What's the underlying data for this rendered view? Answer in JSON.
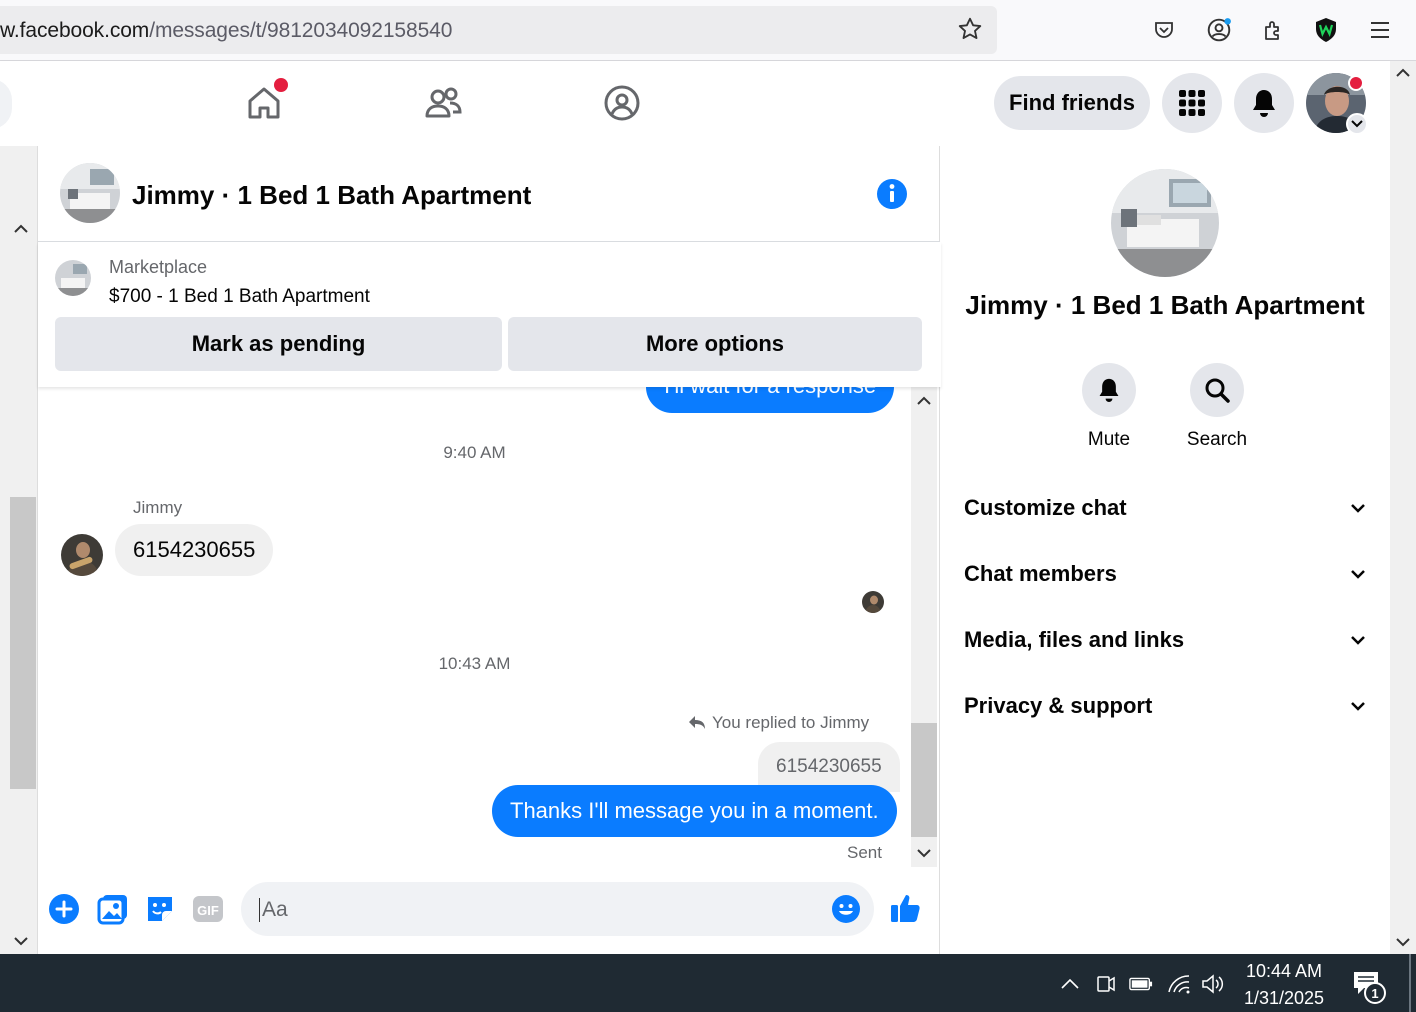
{
  "browser": {
    "url_prefix": "w.",
    "url_domain": "facebook.com",
    "url_path": "/messages/t/9812034092158540"
  },
  "header": {
    "find_friends_label": "Find friends"
  },
  "chat": {
    "title": "Jimmy · 1 Bed 1 Bath Apartment",
    "marketplace_label": "Marketplace",
    "listing": "$700 - 1 Bed 1 Bath Apartment",
    "mark_pending_label": "Mark as pending",
    "more_options_label": "More options",
    "partial_message": "I'll wait for a response",
    "timestamp_1": "9:40 AM",
    "sender_name": "Jimmy",
    "incoming_message": "6154230655",
    "timestamp_2": "10:43 AM",
    "reply_note": "You replied to Jimmy",
    "quoted_message": "6154230655",
    "outgoing_message": "Thanks I'll message you in a moment.",
    "status": "Sent",
    "input_placeholder": "Aa"
  },
  "right_pane": {
    "title": "Jimmy · 1 Bed 1 Bath Apartment",
    "mute_label": "Mute",
    "search_label": "Search",
    "sections": [
      "Customize chat",
      "Chat members",
      "Media, files and links",
      "Privacy & support"
    ]
  },
  "taskbar": {
    "time": "10:44 AM",
    "date": "1/31/2025",
    "notification_count": "1"
  },
  "colors": {
    "fb_blue": "#0a7cff",
    "badge_red": "#e41e3f",
    "taskbar": "#1f2a33"
  }
}
